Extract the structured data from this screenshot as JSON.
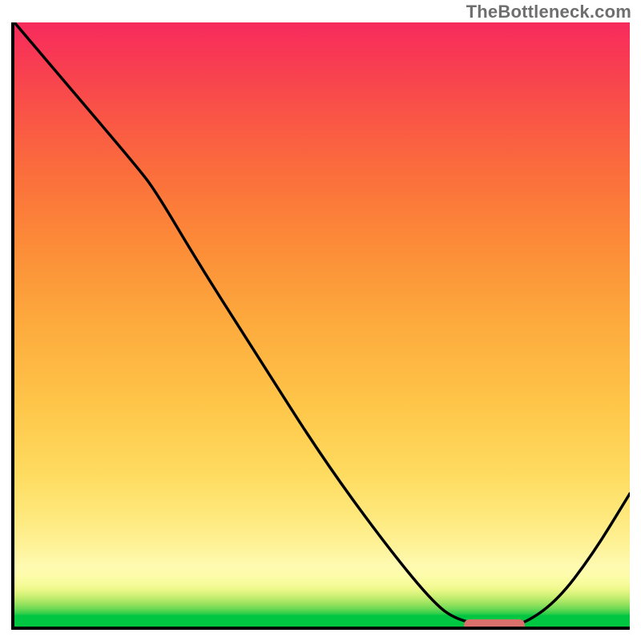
{
  "attribution": "TheBottleneck.com",
  "colors": {
    "curve": "#000000",
    "marker": "#d9706b",
    "axis": "#000000"
  },
  "chart_data": {
    "type": "line",
    "title": "",
    "xlabel": "",
    "ylabel": "",
    "xlim": [
      0,
      100
    ],
    "ylim": [
      0,
      100
    ],
    "grid": false,
    "legend": false,
    "series": [
      {
        "name": "bottleneck-curve",
        "x": [
          0,
          10,
          20,
          23,
          30,
          40,
          50,
          60,
          68,
          72,
          78,
          82,
          88,
          94,
          100
        ],
        "values": [
          100,
          88,
          76,
          72,
          60,
          44,
          28,
          14,
          4,
          1,
          0,
          0,
          4,
          12,
          22
        ]
      }
    ],
    "annotations": [
      {
        "name": "optimal-range-marker",
        "x_start": 73,
        "x_end": 83,
        "y": 0
      }
    ],
    "background_gradient": {
      "orientation": "vertical",
      "stops": [
        {
          "pos": 0.0,
          "color": "#00c642"
        },
        {
          "pos": 0.05,
          "color": "#cbef73"
        },
        {
          "pos": 0.1,
          "color": "#fefab1"
        },
        {
          "pos": 0.25,
          "color": "#fedc60"
        },
        {
          "pos": 0.5,
          "color": "#fdab3d"
        },
        {
          "pos": 0.75,
          "color": "#fb6e3c"
        },
        {
          "pos": 1.0,
          "color": "#f72a5d"
        }
      ]
    }
  }
}
